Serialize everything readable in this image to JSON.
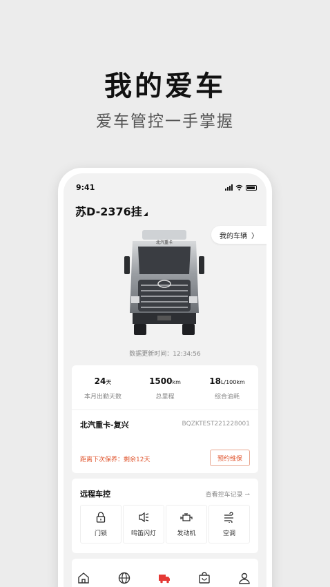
{
  "hero": {
    "title": "我的爱车",
    "subtitle": "爱车管控一手掌握"
  },
  "status_bar": {
    "time": "9:41"
  },
  "vehicle": {
    "plate": "苏D-2376挂",
    "caret": "◢"
  },
  "my_vehicles": {
    "label": "我的车辆",
    "chevron": "〉"
  },
  "update": {
    "label": "数据更新时间：12:34:56"
  },
  "stats": [
    {
      "value": "24",
      "unit": "天",
      "label": "本月出勤天数"
    },
    {
      "value": "1500",
      "unit": "km",
      "label": "总里程"
    },
    {
      "value": "18",
      "unit": "L/100km",
      "label": "综合油耗"
    }
  ],
  "model": {
    "name": "北汽重卡-复兴",
    "vin": "BQZKTEST221228001"
  },
  "maintenance": {
    "text": "距离下次保养：剩余12天",
    "button": "预约维保"
  },
  "remote": {
    "title": "远程车控",
    "link": "查看控车记录 ⇀",
    "controls": [
      {
        "label": "门锁",
        "icon": "lock-icon"
      },
      {
        "label": "鸣笛闪灯",
        "icon": "horn-light-icon"
      },
      {
        "label": "发动机",
        "icon": "engine-icon"
      },
      {
        "label": "空调",
        "icon": "air-conditioner-icon"
      }
    ]
  },
  "tabbar": {
    "tabs": [
      {
        "icon": "home-icon"
      },
      {
        "icon": "globe-icon"
      },
      {
        "icon": "truck-icon",
        "active": true
      },
      {
        "icon": "bag-icon"
      },
      {
        "icon": "user-icon"
      }
    ]
  },
  "colors": {
    "accent": "#e0562f",
    "active_tab": "#e53935"
  }
}
